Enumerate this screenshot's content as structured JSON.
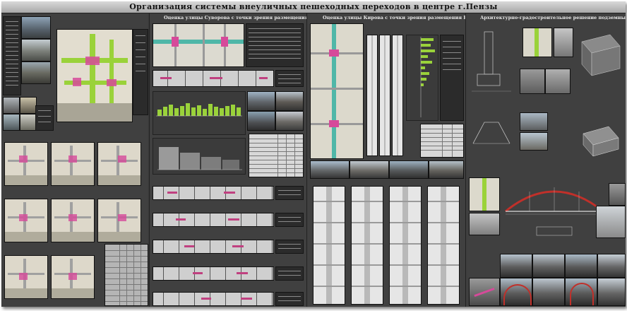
{
  "poster": {
    "title": "Организация системы внеуличных пешеходных переходов в центре г.Пензы"
  },
  "panels": {
    "p2_title": "Оценка улицы Суворова с точки зрения размещения ВПП",
    "p3_title": "Оценка улицы Кирова с точки зрения размещения ВПП",
    "p4_title": "Архитектурно-градостроительное решение подземных переходов"
  },
  "colors": {
    "board": "#3a3a3a",
    "accent_green": "#9ad23a",
    "accent_pink": "#d64a9a",
    "accent_teal": "#4fb7a8",
    "bridge_red": "#c0302a"
  }
}
